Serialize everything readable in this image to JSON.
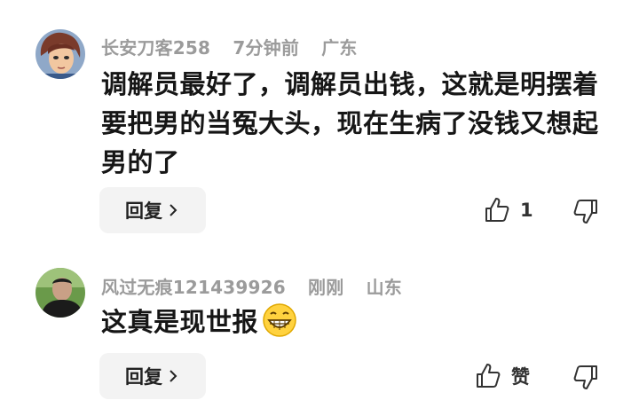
{
  "comments": [
    {
      "username": "长安刀客258",
      "time": "7分钟前",
      "location": "广东",
      "text": "调解员最好了，调解员出钱，这就是明摆着要把男的当冤大头，现在生病了没钱又想起男的了",
      "reply_label": "回复",
      "like_count": "1",
      "avatar_icon": "cartoon-avatar"
    },
    {
      "username": "风过无痕121439926",
      "time": "刚刚",
      "location": "山东",
      "text": "这真是现世报",
      "emoji": "grinning-face-icon",
      "reply_label": "回复",
      "like_label": "赞",
      "avatar_icon": "photo-avatar"
    }
  ],
  "colors": {
    "meta": "#9b9b9b",
    "text": "#161616",
    "button_bg": "#f3f3f3"
  }
}
